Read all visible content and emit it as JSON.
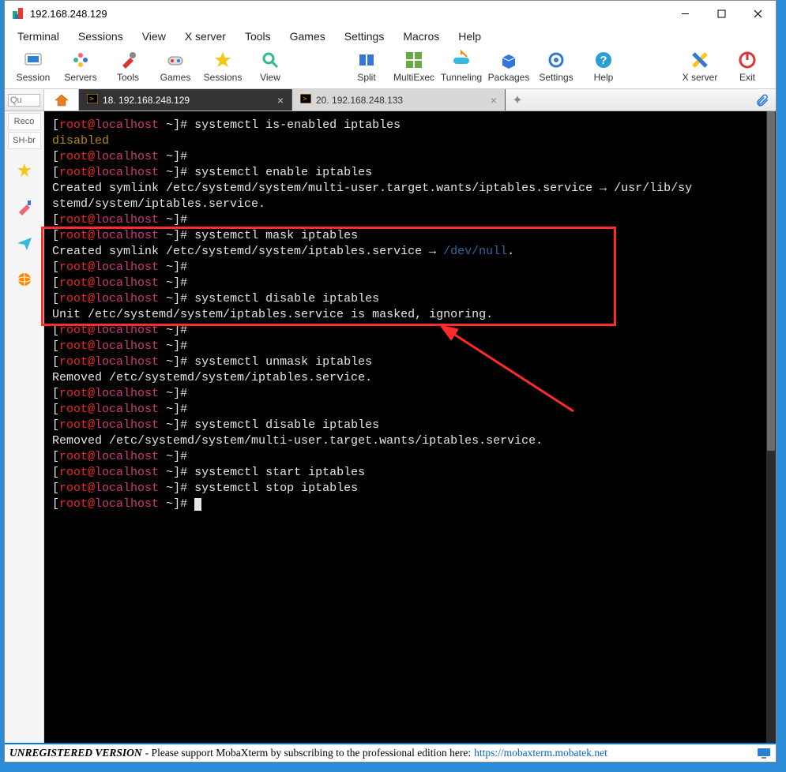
{
  "window": {
    "title": "192.168.248.129"
  },
  "menu": {
    "items": [
      "Terminal",
      "Sessions",
      "View",
      "X server",
      "Tools",
      "Games",
      "Settings",
      "Macros",
      "Help"
    ]
  },
  "toolbar": {
    "left": [
      {
        "label": "Session",
        "icon": "session"
      },
      {
        "label": "Servers",
        "icon": "servers"
      },
      {
        "label": "Tools",
        "icon": "tools"
      },
      {
        "label": "Games",
        "icon": "games"
      },
      {
        "label": "Sessions",
        "icon": "sessions"
      },
      {
        "label": "View",
        "icon": "view"
      }
    ],
    "mid": [
      {
        "label": "Split",
        "icon": "split"
      },
      {
        "label": "MultiExec",
        "icon": "multiexec"
      },
      {
        "label": "Tunneling",
        "icon": "tunneling"
      },
      {
        "label": "Packages",
        "icon": "packages"
      },
      {
        "label": "Settings",
        "icon": "settings"
      },
      {
        "label": "Help",
        "icon": "help"
      }
    ],
    "right": [
      {
        "label": "X server",
        "icon": "xserver"
      },
      {
        "label": "Exit",
        "icon": "exit"
      }
    ]
  },
  "sidebar": {
    "search_placeholder": "Qu",
    "buttons": [
      "Reco",
      "SH-br"
    ],
    "icons": [
      "star-icon",
      "brush-icon",
      "plane-icon",
      "globe-icon"
    ]
  },
  "tabs": {
    "active": {
      "label": "18. 192.168.248.129"
    },
    "inactive": {
      "label": "20. 192.168.248.133"
    }
  },
  "terminal": {
    "lines": [
      {
        "t": "prompt",
        "cmd": "systemctl is-enabled iptables"
      },
      {
        "t": "out",
        "cls": "yel",
        "text": "disabled"
      },
      {
        "t": "prompt",
        "cmd": ""
      },
      {
        "t": "prompt",
        "cmd": "systemctl enable iptables"
      },
      {
        "t": "out",
        "text": "Created symlink /etc/systemd/system/multi-user.target.wants/iptables.service → /usr/lib/sy"
      },
      {
        "t": "out",
        "text": "stemd/system/iptables.service."
      },
      {
        "t": "prompt",
        "cmd": ""
      },
      {
        "t": "prompt",
        "cmd": "systemctl mask iptables"
      },
      {
        "t": "symlink",
        "pre": "Created symlink /etc/systemd/system/iptables.service → ",
        "link": "/dev/null",
        "post": "."
      },
      {
        "t": "prompt",
        "cmd": ""
      },
      {
        "t": "prompt",
        "cmd": ""
      },
      {
        "t": "prompt",
        "cmd": "systemctl disable iptables"
      },
      {
        "t": "out",
        "text": "Unit /etc/systemd/system/iptables.service is masked, ignoring."
      },
      {
        "t": "prompt",
        "cmd": ""
      },
      {
        "t": "prompt",
        "cmd": ""
      },
      {
        "t": "prompt",
        "cmd": "systemctl unmask iptables"
      },
      {
        "t": "out",
        "text": "Removed /etc/systemd/system/iptables.service."
      },
      {
        "t": "prompt",
        "cmd": ""
      },
      {
        "t": "prompt",
        "cmd": ""
      },
      {
        "t": "prompt",
        "cmd": "systemctl disable iptables"
      },
      {
        "t": "out",
        "text": "Removed /etc/systemd/system/multi-user.target.wants/iptables.service."
      },
      {
        "t": "prompt",
        "cmd": ""
      },
      {
        "t": "prompt",
        "cmd": "systemctl start iptables"
      },
      {
        "t": "prompt",
        "cmd": "systemctl stop iptables"
      },
      {
        "t": "prompt",
        "cmd": "",
        "cursor": true
      }
    ],
    "prompt": {
      "user": "root",
      "at": "@",
      "host": "localhost",
      "path": " ~",
      "close": "]#"
    }
  },
  "statusbar": {
    "bold": "UNREGISTERED VERSION",
    "text": "  -  Please support MobaXterm by subscribing to the professional edition here:  ",
    "link": "https://mobaxterm.mobatek.net"
  }
}
